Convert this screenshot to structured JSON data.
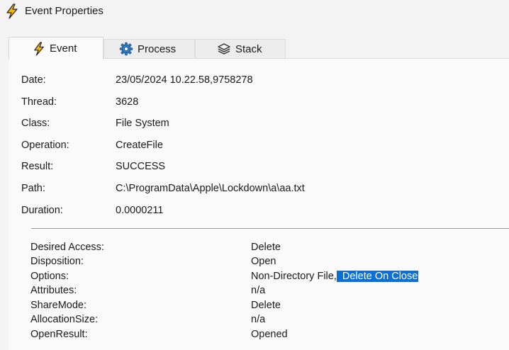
{
  "window": {
    "title": "Event Properties",
    "icon": "lightning-icon"
  },
  "tabs": [
    {
      "label": "Event",
      "icon": "lightning-icon",
      "active": true
    },
    {
      "label": "Process",
      "icon": "gear-icon",
      "active": false
    },
    {
      "label": "Stack",
      "icon": "stack-icon",
      "active": false
    }
  ],
  "event": {
    "date_label": "Date:",
    "date": "23/05/2024 10.22.58,9758278",
    "thread_label": "Thread:",
    "thread": "3628",
    "class_label": "Class:",
    "class": "File System",
    "operation_label": "Operation:",
    "operation": "CreateFile",
    "result_label": "Result:",
    "result": "SUCCESS",
    "path_label": "Path:",
    "path": "C:\\ProgramData\\Apple\\Lockdown\\a\\aa.txt",
    "duration_label": "Duration:",
    "duration": "0.0000211"
  },
  "details": {
    "desired_access_label": "Desired Access:",
    "desired_access": "Delete",
    "disposition_label": "Disposition:",
    "disposition": "Open",
    "options_label": "Options:",
    "options_part1": "Non-Directory File,",
    "options_selected": " Delete On Close",
    "attributes_label": "Attributes:",
    "attributes": "n/a",
    "sharemode_label": "ShareMode:",
    "sharemode": "Delete",
    "allocationsize_label": "AllocationSize:",
    "allocationsize": "n/a",
    "openresult_label": "OpenResult:",
    "openresult": "Opened"
  },
  "colors": {
    "accent_yellow": "#f2b707",
    "gear_blue": "#2f7fc6",
    "selection": "#0b6fd4"
  }
}
